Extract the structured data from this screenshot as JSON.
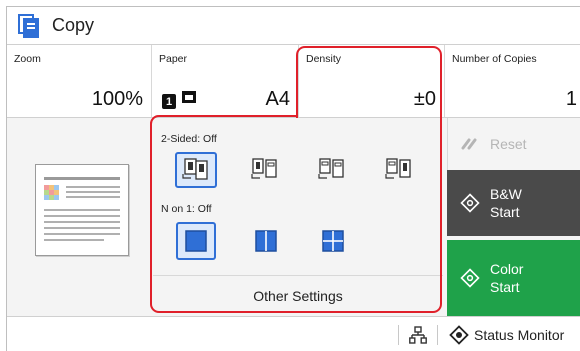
{
  "app": {
    "title": "Copy"
  },
  "settings": {
    "zoom": {
      "label": "Zoom",
      "value": "100%"
    },
    "paper": {
      "label": "Paper",
      "tray": "1",
      "value": "A4"
    },
    "density": {
      "label": "Density",
      "value": "±0"
    },
    "copies": {
      "label": "Number of Copies",
      "value": "1"
    }
  },
  "options": {
    "two_sided_label": "2-Sided: Off",
    "n_on_1_label": "N on 1: Off",
    "other_settings_label": "Other Settings"
  },
  "actions": {
    "reset_label": "Reset",
    "bw_start": {
      "line1": "B&W",
      "line2": "Start"
    },
    "color_start": {
      "line1": "Color",
      "line2": "Start"
    }
  },
  "status": {
    "status_monitor_label": "Status Monitor"
  },
  "colors": {
    "accent": "#2f6fd6",
    "highlight": "#e0202a",
    "bw_start": "#4a4a4a",
    "color_start": "#1fa24a"
  },
  "icons": [
    "copy-app-icon",
    "tray-icon",
    "network-icon",
    "status-monitor-icon",
    "reset-icon",
    "start-icon"
  ]
}
